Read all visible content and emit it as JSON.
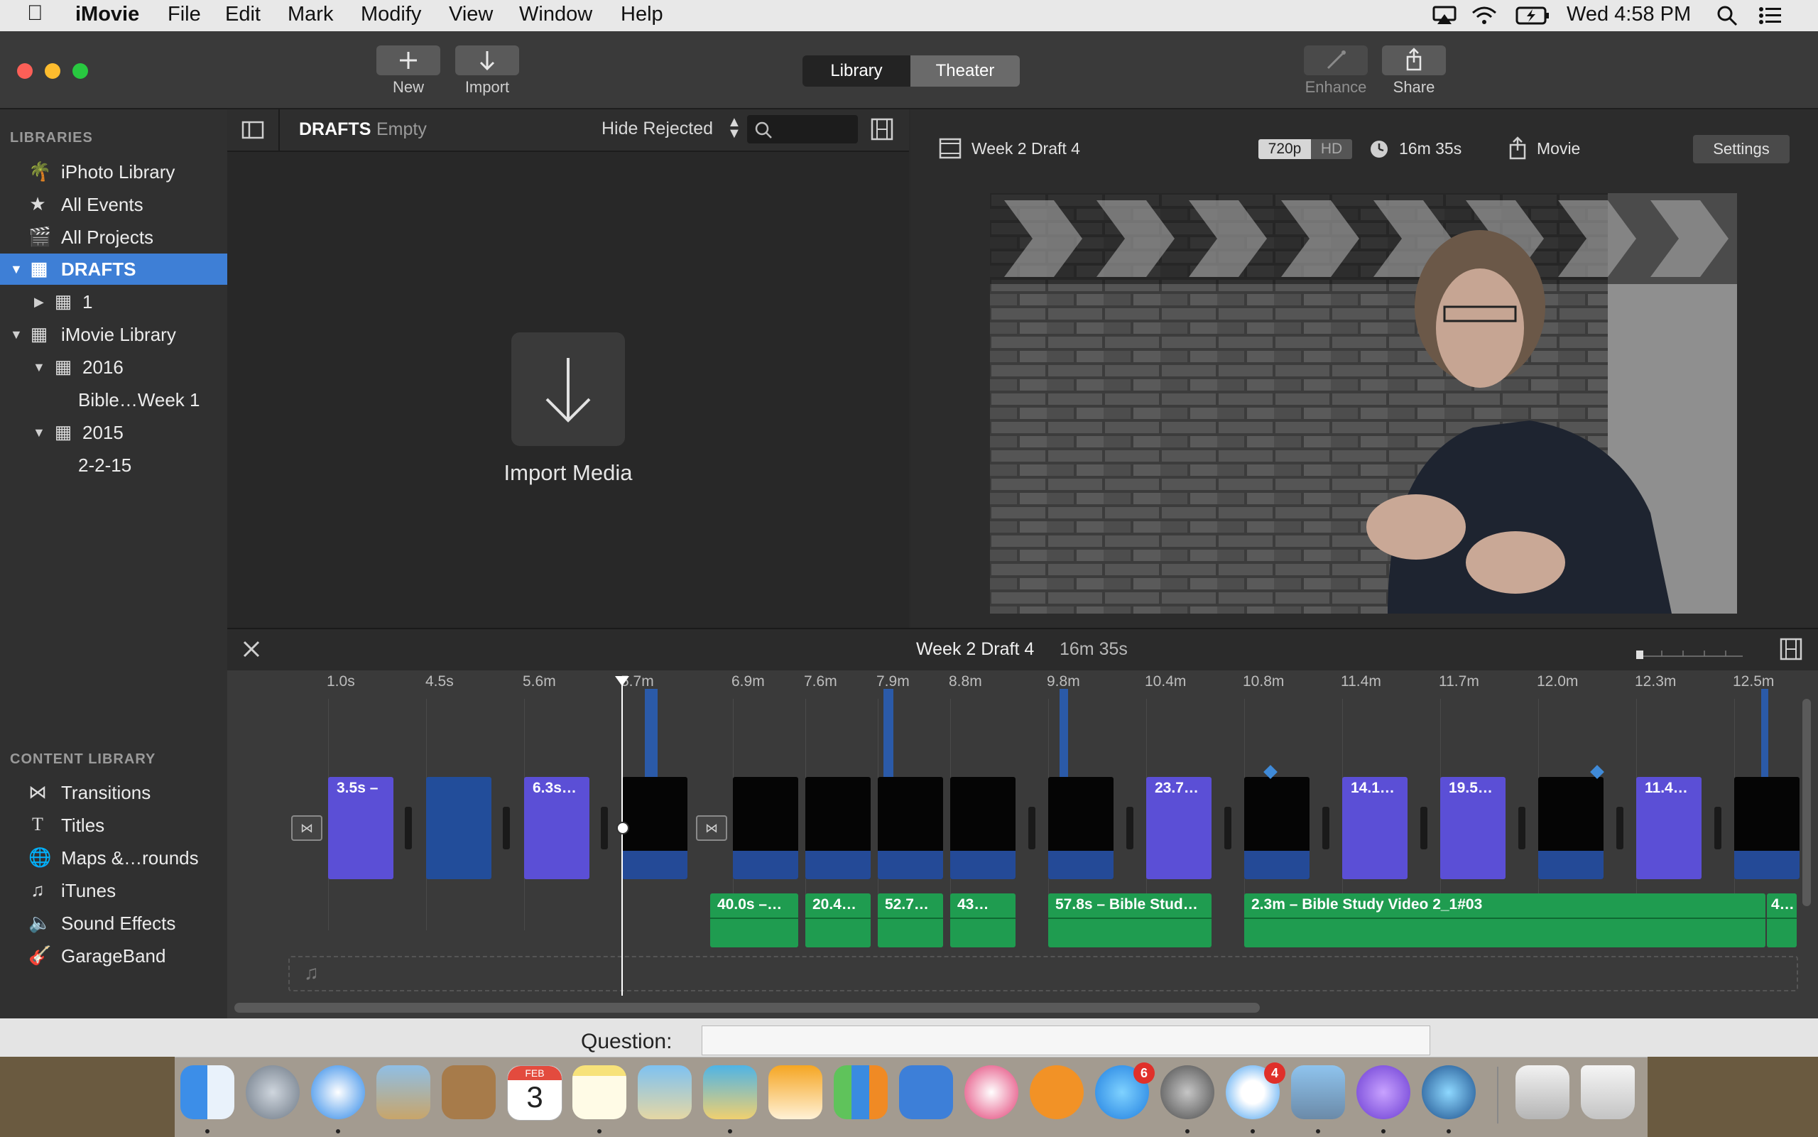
{
  "menubar": {
    "app_name": "iMovie",
    "items": [
      "File",
      "Edit",
      "Mark",
      "Modify",
      "View",
      "Window",
      "Help"
    ],
    "clock": "Wed 4:58 PM"
  },
  "toolbar": {
    "new_label": "New",
    "import_label": "Import",
    "library_tab": "Library",
    "theater_tab": "Theater",
    "enhance_label": "Enhance",
    "share_label": "Share"
  },
  "sidebar": {
    "libraries_header": "LIBRARIES",
    "items": [
      "iPhoto Library",
      "All Events",
      "All Projects",
      "DRAFTS",
      "1",
      "iMovie Library",
      "2016",
      "Bible…Week 1",
      "2015",
      "2-2-15"
    ],
    "content_header": "CONTENT LIBRARY",
    "content_items": [
      "Transitions",
      "Titles",
      "Maps &…rounds",
      "iTunes",
      "Sound Effects",
      "GarageBand"
    ]
  },
  "browser": {
    "title": "DRAFTS",
    "status": "Empty",
    "filter": "Hide Rejected",
    "search_placeholder": "",
    "import_media": "Import Media"
  },
  "viewer": {
    "project_name": "Week 2 Draft 4",
    "res_720": "720p",
    "res_hd": "HD",
    "duration": "16m 35s",
    "share_target": "Movie",
    "settings": "Settings"
  },
  "timeline": {
    "title": "Week 2 Draft 4",
    "duration": "16m 35s",
    "ticks": [
      "1.0s",
      "4.5s",
      "5.6m",
      "5.7m",
      "6.9m",
      "7.6m",
      "7.9m",
      "8.8m",
      "9.8m",
      "10.4m",
      "10.8m",
      "11.4m",
      "11.7m",
      "12.0m",
      "12.3m",
      "12.5m"
    ],
    "clip_labels": [
      "3.5s –",
      "6.3s…",
      "23.7…",
      "14.1…",
      "19.5…",
      "11.4…"
    ],
    "audio_labels": [
      "40.0s –…",
      "20.4…",
      "52.7…",
      "43…",
      "57.8s – Bible Stud…",
      "2.3m – Bible Study Video 2_1#03",
      "4…"
    ]
  },
  "below_window": {
    "question_label": "Question:"
  },
  "dock": {
    "calendar_month": "FEB",
    "calendar_day": "3",
    "appstore_badge": "6",
    "messages_badge": "4"
  },
  "colors": {
    "selection": "#3e7fd6",
    "clip_purple": "#5b4fd6",
    "clip_blue": "#224d9a",
    "audio_green": "#1f9c50"
  }
}
